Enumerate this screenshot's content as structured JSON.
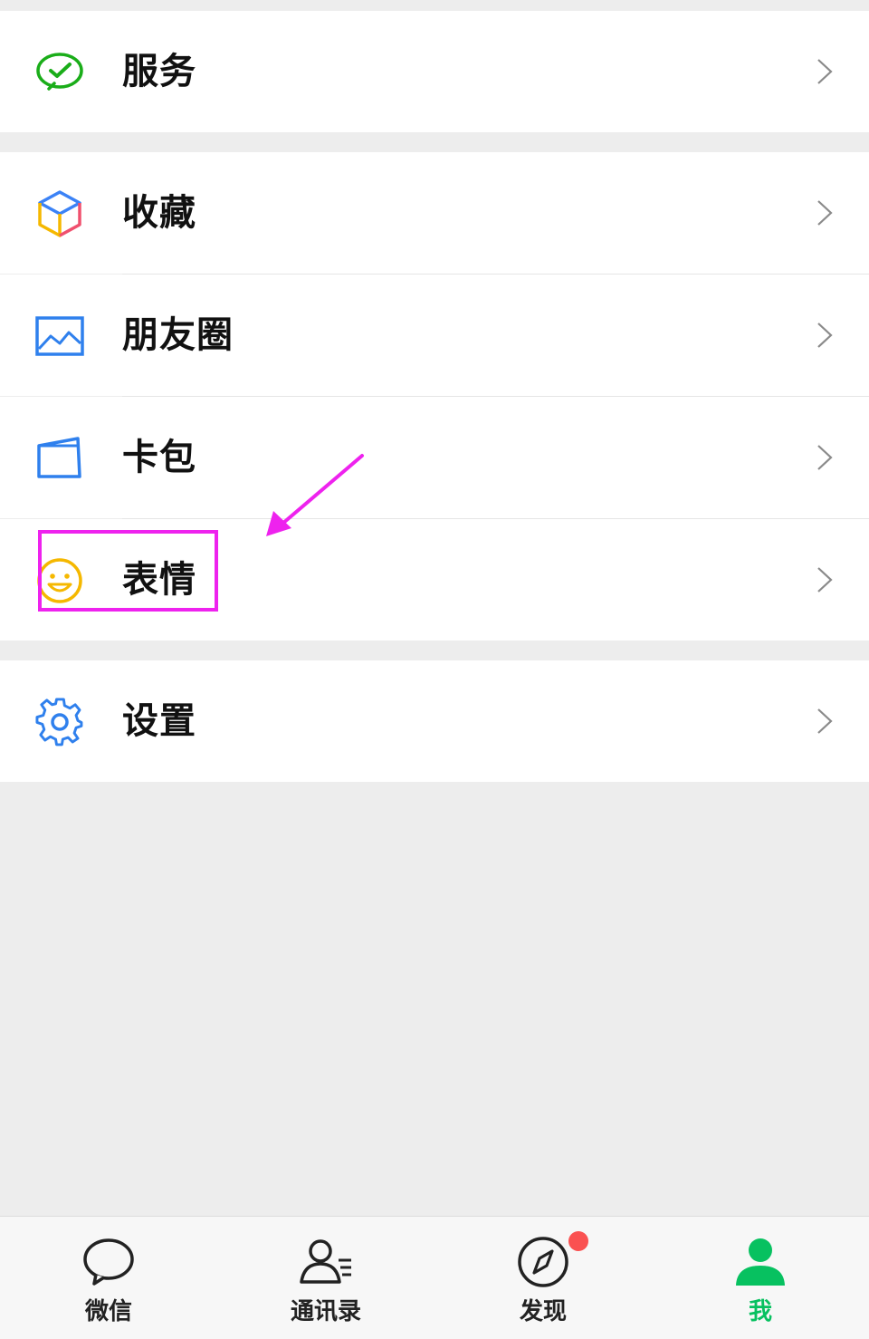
{
  "menu": {
    "services": {
      "label": "服务",
      "icon": "wechat-pay-icon"
    },
    "favorites": {
      "label": "收藏",
      "icon": "cube-icon"
    },
    "moments": {
      "label": "朋友圈",
      "icon": "photo-icon"
    },
    "cards": {
      "label": "卡包",
      "icon": "card-icon"
    },
    "stickers": {
      "label": "表情",
      "icon": "smiley-icon"
    },
    "settings": {
      "label": "设置",
      "icon": "gear-icon"
    }
  },
  "tabbar": {
    "chats": {
      "label": "微信",
      "icon": "chat-bubble-icon"
    },
    "contacts": {
      "label": "通讯录",
      "icon": "contacts-icon"
    },
    "discover": {
      "label": "发现",
      "icon": "compass-icon",
      "badge": true
    },
    "me": {
      "label": "我",
      "icon": "person-icon",
      "active": true
    }
  },
  "colors": {
    "accent": "#07c160",
    "highlight": "#ee22ee",
    "badge": "#fa5151"
  }
}
